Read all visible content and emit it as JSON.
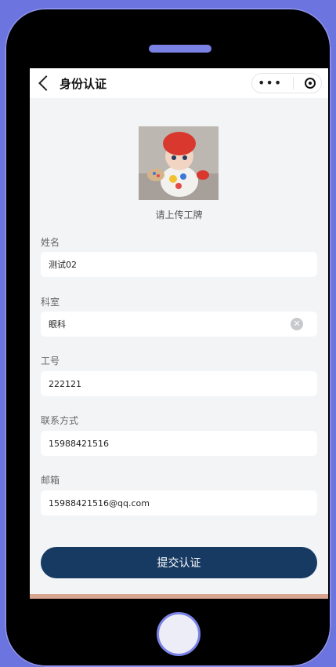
{
  "navbar": {
    "title": "身份认证",
    "back_icon": "chevron-left-icon",
    "more_icon": "•••",
    "target_icon": "target-icon"
  },
  "upload": {
    "label": "请上传工牌"
  },
  "fields": {
    "name": {
      "label": "姓名",
      "value": "测试02"
    },
    "department": {
      "label": "科室",
      "value": "眼科"
    },
    "employee_id": {
      "label": "工号",
      "value": "222121"
    },
    "phone": {
      "label": "联系方式",
      "value": "15988421516"
    },
    "email": {
      "label": "邮箱",
      "value": "15988421516@qq.com"
    }
  },
  "submit": {
    "label": "提交认证"
  },
  "colors": {
    "accent": "#173a63",
    "page_bg": "#6b74df",
    "screen_bg": "#f3f4f6"
  }
}
